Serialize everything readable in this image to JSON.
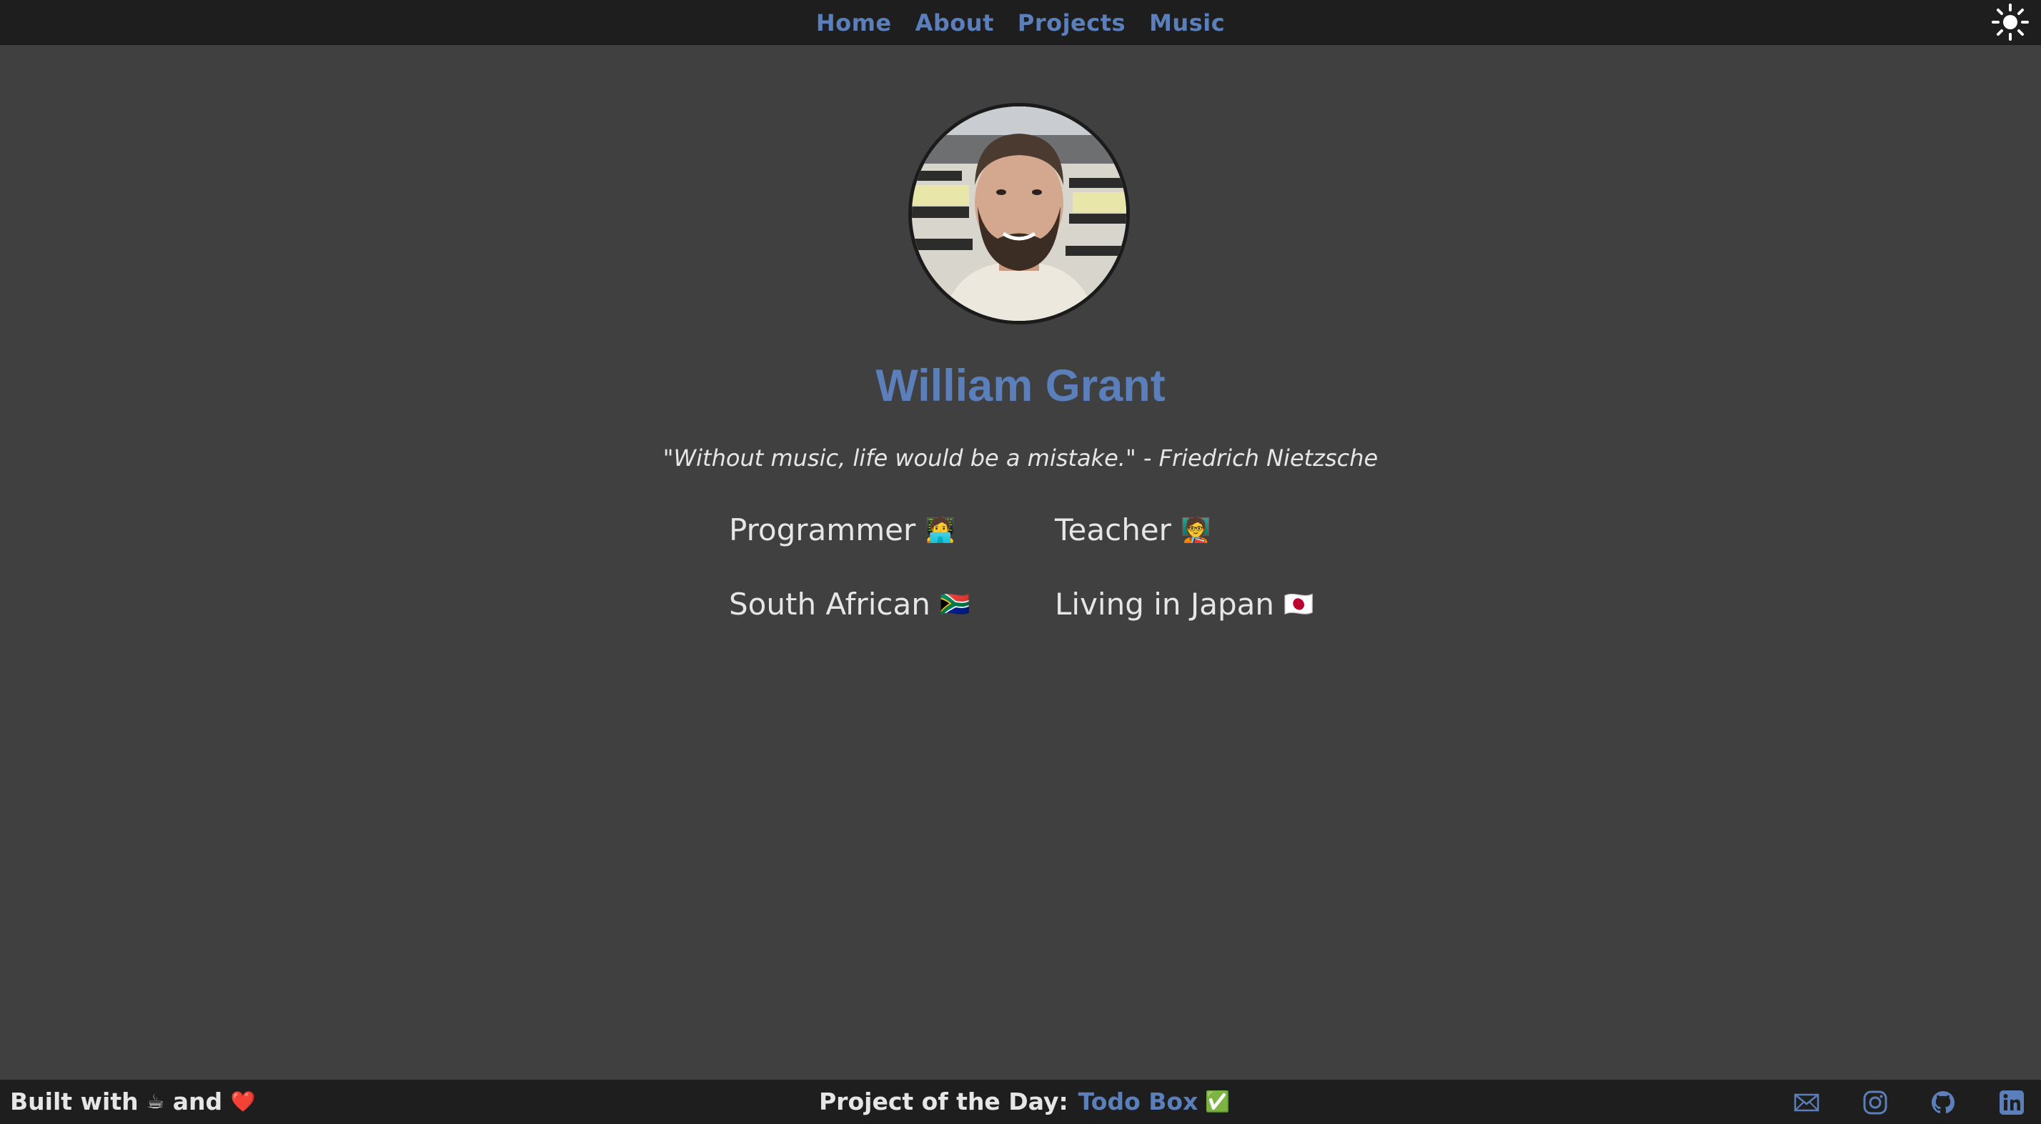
{
  "nav": {
    "links": [
      "Home",
      "About",
      "Projects",
      "Music"
    ],
    "theme_icon": "sun-icon"
  },
  "profile": {
    "name": "William Grant",
    "quote": "\"Without music, life would be a mistake.\" - Friedrich Nietzsche",
    "traits": [
      {
        "label": "Programmer",
        "emoji": "🧑‍💻"
      },
      {
        "label": "Teacher",
        "emoji": "🧑‍🏫"
      },
      {
        "label": "South African",
        "emoji": "🇿🇦"
      },
      {
        "label": "Living in Japan",
        "emoji": "🇯🇵"
      }
    ]
  },
  "footer": {
    "built_with": "Built with",
    "coffee_emoji": "☕",
    "and": "and",
    "heart_emoji": "❤️",
    "project_label": "Project of the Day:",
    "project_name": "Todo Box",
    "project_emoji": "✅",
    "social_icons": [
      "mail-icon",
      "instagram-icon",
      "github-icon",
      "linkedin-icon"
    ]
  },
  "colors": {
    "accent": "#5b7fbb",
    "background": "#404040",
    "bar": "#1e1e1e",
    "text": "#e6e6e6"
  }
}
